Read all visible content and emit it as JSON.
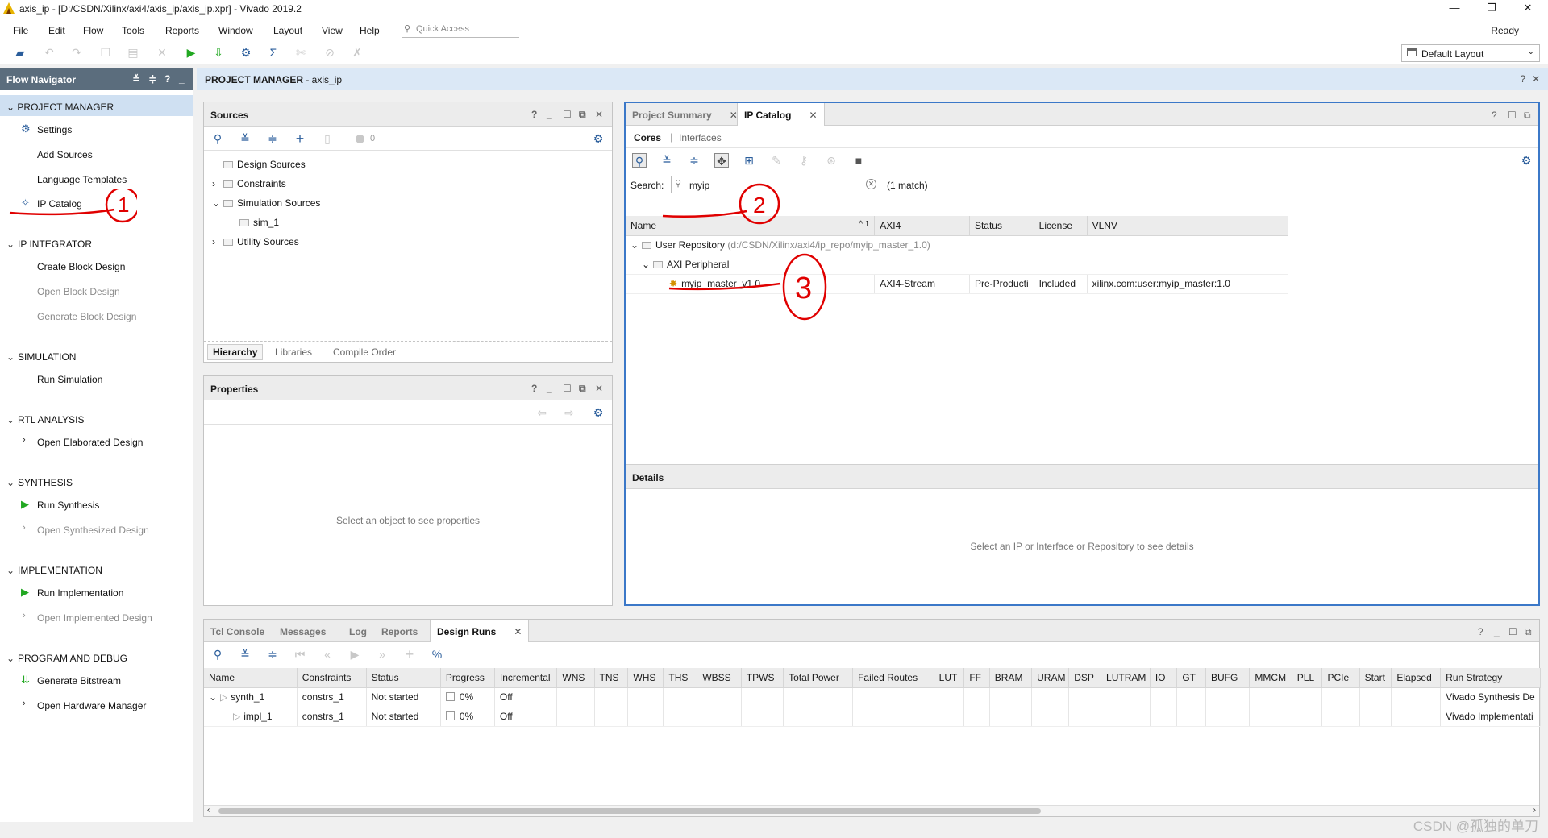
{
  "window": {
    "title": "axis_ip - [D:/CSDN/Xilinx/axi4/axis_ip/axis_ip.xpr] - Vivado 2019.2",
    "minimize": "—",
    "restore": "❐",
    "close": "✕"
  },
  "menu": {
    "items": [
      "File",
      "Edit",
      "Flow",
      "Tools",
      "Reports",
      "Window",
      "Layout",
      "View",
      "Help"
    ],
    "quick_access_placeholder": "Quick Access",
    "status": "Ready"
  },
  "toolbar": {
    "layout_select": "Default Layout"
  },
  "flow_navigator": {
    "title": "Flow Navigator",
    "sections": [
      {
        "label": "PROJECT MANAGER",
        "items": [
          "Settings",
          "Add Sources",
          "Language Templates",
          "IP Catalog"
        ]
      },
      {
        "label": "IP INTEGRATOR",
        "items": [
          "Create Block Design",
          "Open Block Design",
          "Generate Block Design"
        ]
      },
      {
        "label": "SIMULATION",
        "items": [
          "Run Simulation"
        ]
      },
      {
        "label": "RTL ANALYSIS",
        "items": [
          "Open Elaborated Design"
        ]
      },
      {
        "label": "SYNTHESIS",
        "items": [
          "Run Synthesis",
          "Open Synthesized Design"
        ]
      },
      {
        "label": "IMPLEMENTATION",
        "items": [
          "Run Implementation",
          "Open Implemented Design"
        ]
      },
      {
        "label": "PROGRAM AND DEBUG",
        "items": [
          "Generate Bitstream",
          "Open Hardware Manager"
        ]
      }
    ]
  },
  "project_manager": {
    "title_prefix": "PROJECT MANAGER",
    "title_project": " - axis_ip"
  },
  "sources": {
    "title": "Sources",
    "count": "0",
    "tree": [
      "Design Sources",
      "Constraints",
      "Simulation Sources",
      "sim_1",
      "Utility Sources"
    ],
    "tabs": [
      "Hierarchy",
      "Libraries",
      "Compile Order"
    ]
  },
  "properties": {
    "title": "Properties",
    "empty": "Select an object to see properties"
  },
  "ip_catalog": {
    "tabs": [
      "Project Summary",
      "IP Catalog"
    ],
    "subtabs": [
      "Cores",
      "Interfaces"
    ],
    "search_label": "Search:",
    "search_value": "myip",
    "match_text": "(1 match)",
    "columns": [
      "Name",
      "AXI4",
      "Status",
      "License",
      "VLNV"
    ],
    "sort_indicator": "^ 1",
    "repo_label": "User Repository",
    "repo_path": "(d:/CSDN/Xilinx/axi4/ip_repo/myip_master_1.0)",
    "group_label": "AXI Peripheral",
    "core": {
      "name": "myip_master_v1.0",
      "axi4": "AXI4-Stream",
      "status": "Pre-Producti",
      "license": "Included",
      "vlnv": "xilinx.com:user:myip_master:1.0"
    },
    "details_title": "Details",
    "details_empty": "Select an IP or Interface or Repository to see details"
  },
  "bottom": {
    "tabs": [
      "Tcl Console",
      "Messages",
      "Log",
      "Reports",
      "Design Runs"
    ],
    "columns": [
      "Name",
      "Constraints",
      "Status",
      "Progress",
      "Incremental",
      "WNS",
      "TNS",
      "WHS",
      "THS",
      "WBSS",
      "TPWS",
      "Total Power",
      "Failed Routes",
      "LUT",
      "FF",
      "BRAM",
      "URAM",
      "DSP",
      "LUTRAM",
      "IO",
      "GT",
      "BUFG",
      "MMCM",
      "PLL",
      "PCIe",
      "Start",
      "Elapsed",
      "Run Strategy"
    ],
    "runs": [
      {
        "name": "synth_1",
        "constraints": "constrs_1",
        "status": "Not started",
        "progress": "0%",
        "incremental": "Off",
        "strategy": "Vivado Synthesis De"
      },
      {
        "name": "impl_1",
        "constraints": "constrs_1",
        "status": "Not started",
        "progress": "0%",
        "incremental": "Off",
        "strategy": "Vivado Implementati"
      }
    ]
  },
  "annotations": {
    "mark1": "1",
    "mark2": "2",
    "mark3": "3"
  },
  "watermark": "CSDN @孤独的单刀"
}
